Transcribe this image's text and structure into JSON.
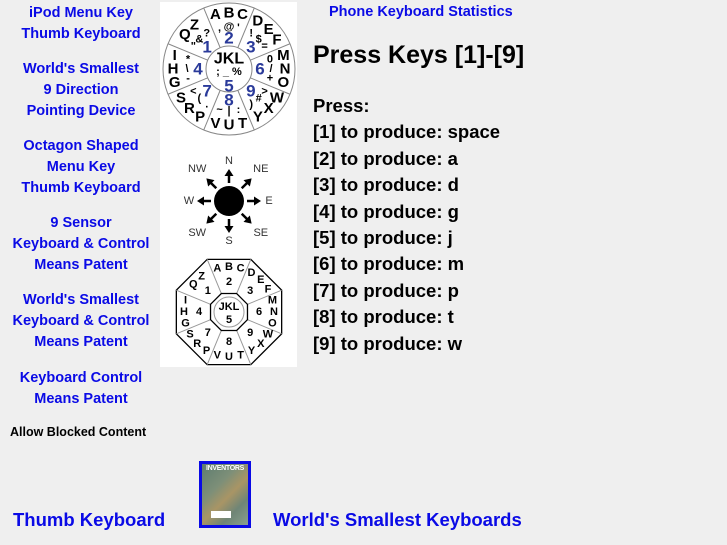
{
  "sidebar": {
    "links": [
      {
        "lines": [
          "iPod Menu Key",
          "Thumb Keyboard"
        ]
      },
      {
        "lines": [
          "World's Smallest",
          "9 Direction",
          "Pointing Device"
        ]
      },
      {
        "lines": [
          "Octagon Shaped",
          "Menu Key",
          "Thumb Keyboard"
        ]
      },
      {
        "lines": [
          "9 Sensor",
          "Keyboard & Control",
          "Means Patent"
        ]
      },
      {
        "lines": [
          "World's Smallest",
          "Keyboard & Control",
          "Means Patent"
        ]
      },
      {
        "lines": [
          "Keyboard Control",
          "Means Patent"
        ]
      }
    ],
    "allow_blocked": "Allow Blocked Content"
  },
  "colors": {
    "link": "#0a0ae6",
    "digit": "#2a3a9a",
    "background": "#efefef"
  },
  "circle_keyboard": {
    "center": {
      "letters": "JKL",
      "symbols": "; _ %",
      "digit": "5"
    },
    "sectors": [
      {
        "digit": "2",
        "letters": "ABC",
        "symbols": ", @ '"
      },
      {
        "digit": "3",
        "letters": "DEF",
        "symbols": "! $ ="
      },
      {
        "digit": "6",
        "letters": "MNO",
        "symbols": "0 / +"
      },
      {
        "digit": "9",
        "letters": "WXY",
        "symbols": "> # )"
      },
      {
        "digit": "8",
        "letters": "TUV",
        "symbols": ": | ~"
      },
      {
        "digit": "7",
        "letters": "PRS",
        "symbols": ". ( <"
      },
      {
        "digit": "4",
        "letters": "GHI",
        "symbols": "- \\ *"
      },
      {
        "digit": "1",
        "letters": "QZ",
        "symbols": "\" & ?"
      }
    ]
  },
  "compass": {
    "directions": [
      "N",
      "NE",
      "E",
      "SE",
      "S",
      "SW",
      "W",
      "NW"
    ]
  },
  "octagon_keyboard": {
    "center": {
      "letters": "JKL",
      "digit": "5"
    },
    "sectors": [
      {
        "digit": "2",
        "letters": "ABC"
      },
      {
        "digit": "3",
        "letters": "DEF"
      },
      {
        "digit": "6",
        "letters": "MNO"
      },
      {
        "digit": "9",
        "letters": "WXY"
      },
      {
        "digit": "8",
        "letters": "TUV"
      },
      {
        "digit": "7",
        "letters": "PRS"
      },
      {
        "digit": "4",
        "letters": "GHI"
      },
      {
        "digit": "1",
        "letters": "QZ"
      }
    ]
  },
  "main": {
    "stats_link": "Phone Keyboard Statistics",
    "heading": "Press Keys [1]-[9]",
    "press_label": "Press:",
    "press_lines": [
      "[1] to produce: space",
      "[2] to produce: a",
      "[3] to produce: d",
      "[4] to produce: g",
      "[5] to produce: j",
      "[6] to produce: m",
      "[7] to produce: p",
      "[8] to produce: t",
      "[9] to produce: w"
    ]
  },
  "footer": {
    "left_link": "Thumb Keyboard",
    "right_link": "World's Smallest Keyboards",
    "magazine_title": "INVENTORS"
  }
}
